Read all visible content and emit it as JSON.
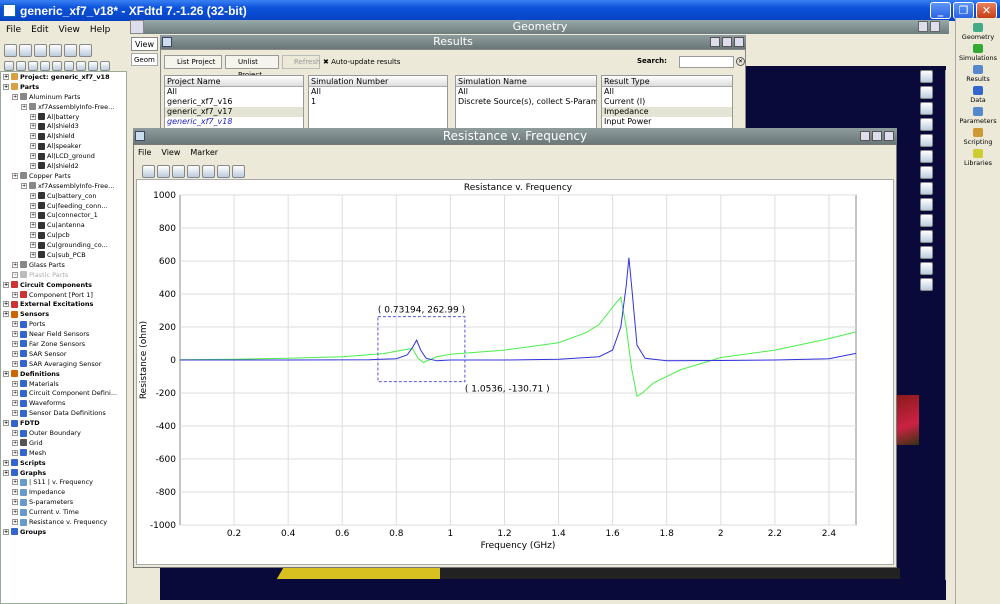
{
  "window": {
    "title": "generic_xf7_v18* - XFdtd 7.-1.26 (32-bit)",
    "min": "_",
    "max": "❐",
    "close": "✕"
  },
  "menu": [
    "File",
    "Edit",
    "View",
    "Help"
  ],
  "geometry_title": "Geometry",
  "view_tab": "View",
  "geom_tab": "Geom",
  "tree": [
    {
      "t": "Project: generic_xf7_v18",
      "l": 0,
      "b": true,
      "c": "#d8a040"
    },
    {
      "t": "Parts",
      "l": 0,
      "b": true,
      "c": "#d8a040"
    },
    {
      "t": "Aluminum Parts",
      "l": 1,
      "c": "#888"
    },
    {
      "t": "xf7AssemblyInfo-Free...",
      "l": 2,
      "c": "#888"
    },
    {
      "t": "Al|battery",
      "l": 3,
      "c": "#333"
    },
    {
      "t": "Al|shield3",
      "l": 3,
      "c": "#333"
    },
    {
      "t": "Al|shield",
      "l": 3,
      "c": "#333"
    },
    {
      "t": "Al|speaker",
      "l": 3,
      "c": "#333"
    },
    {
      "t": "Al|LCD_ground",
      "l": 3,
      "c": "#333"
    },
    {
      "t": "Al|shield2",
      "l": 3,
      "c": "#333"
    },
    {
      "t": "Copper Parts",
      "l": 1,
      "c": "#888"
    },
    {
      "t": "xf7AssemblyInfo-Free...",
      "l": 2,
      "c": "#888"
    },
    {
      "t": "Cu|battery_con",
      "l": 3,
      "c": "#333"
    },
    {
      "t": "Cu|feeding_conn...",
      "l": 3,
      "c": "#333"
    },
    {
      "t": "Cu|connector_1",
      "l": 3,
      "c": "#333"
    },
    {
      "t": "Cu|antenna",
      "l": 3,
      "c": "#333"
    },
    {
      "t": "Cu|pcb",
      "l": 3,
      "c": "#333"
    },
    {
      "t": "Cu|grounding_co...",
      "l": 3,
      "c": "#333"
    },
    {
      "t": "Cu|sub_PCB",
      "l": 3,
      "c": "#333"
    },
    {
      "t": "Glass Parts",
      "l": 1,
      "c": "#888"
    },
    {
      "t": "Plastic Parts",
      "l": 1,
      "c": "#bbb",
      "d": true
    },
    {
      "t": "Circuit Components",
      "l": 0,
      "b": true,
      "c": "#c33"
    },
    {
      "t": "Component [Port 1]",
      "l": 1,
      "c": "#c33"
    },
    {
      "t": "External Excitations",
      "l": 0,
      "b": true,
      "c": "#c33"
    },
    {
      "t": "Sensors",
      "l": 0,
      "b": true,
      "c": "#c60"
    },
    {
      "t": "Ports",
      "l": 1,
      "c": "#36c"
    },
    {
      "t": "Near Field Sensors",
      "l": 1,
      "c": "#36c"
    },
    {
      "t": "Far Zone Sensors",
      "l": 1,
      "c": "#36c"
    },
    {
      "t": "SAR Sensor",
      "l": 1,
      "c": "#36c"
    },
    {
      "t": "SAR Averaging Sensor",
      "l": 1,
      "c": "#36c"
    },
    {
      "t": "Definitions",
      "l": 0,
      "b": true,
      "c": "#c60"
    },
    {
      "t": "Materials",
      "l": 1,
      "c": "#36c"
    },
    {
      "t": "Circuit Component Defini...",
      "l": 1,
      "c": "#36c"
    },
    {
      "t": "Waveforms",
      "l": 1,
      "c": "#36c"
    },
    {
      "t": "Sensor Data Definitions",
      "l": 1,
      "c": "#36c"
    },
    {
      "t": "FDTD",
      "l": 0,
      "b": true,
      "c": "#36c"
    },
    {
      "t": "Outer Boundary",
      "l": 1,
      "c": "#36c"
    },
    {
      "t": "Grid",
      "l": 1,
      "c": "#555"
    },
    {
      "t": "Mesh",
      "l": 1,
      "c": "#36c"
    },
    {
      "t": "Scripts",
      "l": 0,
      "b": true,
      "c": "#36c"
    },
    {
      "t": "Graphs",
      "l": 0,
      "b": true,
      "c": "#36c"
    },
    {
      "t": "| S11 | v. Frequency",
      "l": 1,
      "c": "#69c"
    },
    {
      "t": "Impedance",
      "l": 1,
      "c": "#69c"
    },
    {
      "t": "S-parameters",
      "l": 1,
      "c": "#69c"
    },
    {
      "t": "Current v. Time",
      "l": 1,
      "c": "#69c"
    },
    {
      "t": "Resistance v. Frequency",
      "l": 1,
      "c": "#69c"
    },
    {
      "t": "Groups",
      "l": 0,
      "b": true,
      "c": "#36c"
    }
  ],
  "results": {
    "title": "Results",
    "list_project": "List Project",
    "unlist_project": "Unlist Project",
    "refresh": "Refresh",
    "auto_update": "Auto-update results",
    "search_label": "Search:",
    "columns": [
      {
        "h": "Project Name",
        "items": [
          "All",
          "generic_xf7_v16",
          "generic_xf7_v17",
          "generic_xf7_v18"
        ]
      },
      {
        "h": "Simulation Number",
        "items": [
          "All",
          "1"
        ]
      },
      {
        "h": "Simulation Name",
        "items": [
          "All",
          "Discrete Source(s), collect S-Param..."
        ]
      },
      {
        "h": "Result Type",
        "items": [
          "All",
          "Current (I)",
          "Impedance",
          "Input Power"
        ]
      }
    ]
  },
  "plot_window": {
    "title": "Resistance v. Frequency",
    "menu": [
      "File",
      "View",
      "Marker"
    ]
  },
  "dock": [
    "Geometry",
    "Simulations",
    "Results",
    "Data",
    "Parameters",
    "Scripting",
    "Libraries"
  ],
  "chart_data": {
    "type": "line",
    "title": "Resistance v. Frequency",
    "xlabel": "Frequency (GHz)",
    "ylabel": "Resistance (ohm)",
    "xlim": [
      0,
      2.5
    ],
    "ylim": [
      -1000,
      1000
    ],
    "xticks": [
      0.2,
      0.4,
      0.6,
      0.8,
      1,
      1.2,
      1.4,
      1.6,
      1.8,
      2,
      2.2,
      2.4
    ],
    "yticks": [
      1000,
      800,
      600,
      400,
      200,
      0,
      -200,
      -400,
      -600,
      -800,
      -1000
    ],
    "grid": true,
    "series": [
      {
        "color": "#4aee4a",
        "x": [
          0,
          0.2,
          0.4,
          0.6,
          0.75,
          0.83,
          0.86,
          0.88,
          0.9,
          0.95,
          1.0,
          1.2,
          1.4,
          1.5,
          1.55,
          1.6,
          1.63,
          1.65,
          1.67,
          1.69,
          1.71,
          1.75,
          1.85,
          2.0,
          2.2,
          2.4,
          2.5
        ],
        "y": [
          2,
          5,
          10,
          20,
          38,
          62,
          70,
          10,
          -15,
          20,
          35,
          60,
          105,
          165,
          215,
          320,
          380,
          200,
          -50,
          -220,
          -200,
          -140,
          -60,
          15,
          60,
          130,
          170
        ]
      },
      {
        "color": "#3333dd",
        "x": [
          0,
          0.4,
          0.7,
          0.8,
          0.84,
          0.86,
          0.875,
          0.89,
          0.91,
          0.95,
          1.0,
          1.2,
          1.4,
          1.55,
          1.6,
          1.63,
          1.65,
          1.66,
          1.67,
          1.69,
          1.72,
          1.8,
          2.0,
          2.2,
          2.4,
          2.5
        ],
        "y": [
          0,
          0,
          2,
          8,
          30,
          75,
          120,
          60,
          10,
          -5,
          0,
          0,
          5,
          20,
          60,
          200,
          450,
          620,
          450,
          90,
          10,
          -5,
          -3,
          0,
          8,
          40
        ]
      }
    ],
    "markers": [
      {
        "label": "( 0.73194, 262.99 )",
        "x": 0.73194,
        "y": 262.99
      },
      {
        "label": "( 1.0536, -130.71 )",
        "x": 1.0536,
        "y": -130.71
      }
    ]
  }
}
